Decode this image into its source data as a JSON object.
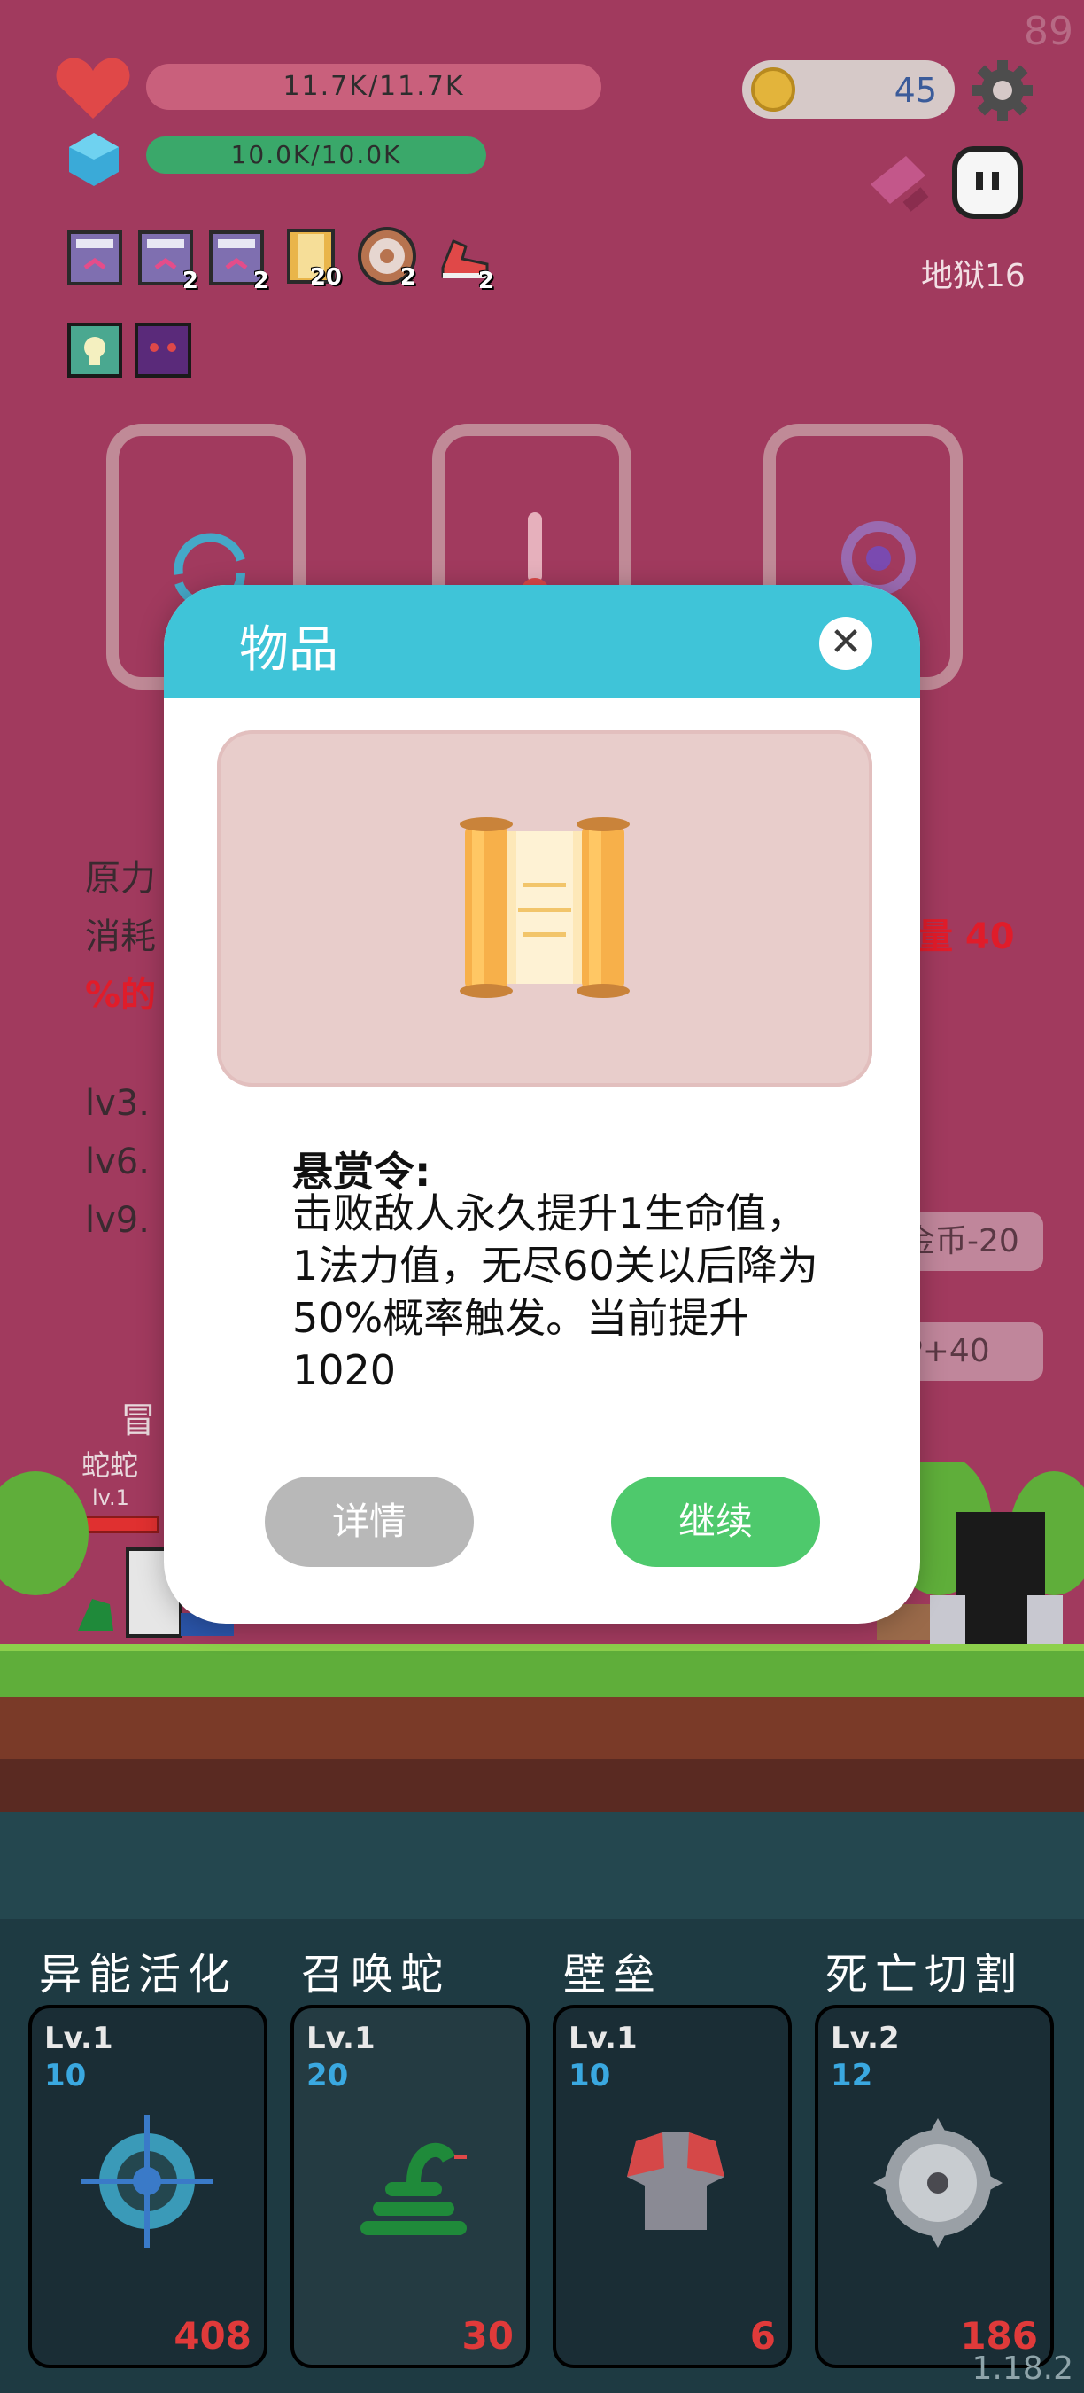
{
  "hud": {
    "hp_text": "11.7K/11.7K",
    "mp_text": "10.0K/10.0K",
    "coins": "45",
    "level_label": "地狱16",
    "fps_counter": "89"
  },
  "inventory": [
    {
      "name": "ribbon-box-icon",
      "count": ""
    },
    {
      "name": "ribbon-box-icon",
      "count": "2"
    },
    {
      "name": "ribbon-box-icon",
      "count": "2"
    },
    {
      "name": "scroll-icon",
      "count": "20"
    },
    {
      "name": "target-shield-icon",
      "count": "2"
    },
    {
      "name": "sneaker-icon",
      "count": "2"
    }
  ],
  "background_text": {
    "line1": "原力",
    "line2": "消耗",
    "line2_right": "量 40",
    "line3": "%的",
    "lv3": "lv3.",
    "lv6": "lv6.",
    "lv9": "lv9.",
    "pill1": "金币-20",
    "pill2": "P+40",
    "adventure": "冒",
    "enemy_name": "蛇蛇",
    "enemy_level": "lv.1"
  },
  "modal": {
    "title": "物品",
    "close_symbol": "✕",
    "item_name": "悬赏令:",
    "description": "击败敌人永久提升1生命值，1法力值，无尽60关以后降为50%概率触发。当前提升1020",
    "detail_button": "详情",
    "continue_button": "继续"
  },
  "skills": [
    {
      "title": "异能活化",
      "level": "Lv.1",
      "cost": "10",
      "count": "408",
      "icon": "crosshair-icon"
    },
    {
      "title": "召唤蛇",
      "level": "Lv.1",
      "cost": "20",
      "count": "30",
      "icon": "snake-icon"
    },
    {
      "title": "壁垒",
      "level": "Lv.1",
      "cost": "10",
      "count": "6",
      "icon": "armor-icon"
    },
    {
      "title": "死亡切割",
      "level": "Lv.2",
      "cost": "12",
      "count": "186",
      "icon": "saw-blade-icon"
    }
  ],
  "version": "1.18.2",
  "colors": {
    "bg": "#a13a5e",
    "modal_header": "#3fc4d8",
    "continue": "#4ec96c",
    "detail": "#b8b8b8",
    "hp_bar": "#c9607c",
    "mp_bar": "#3aa86a"
  }
}
